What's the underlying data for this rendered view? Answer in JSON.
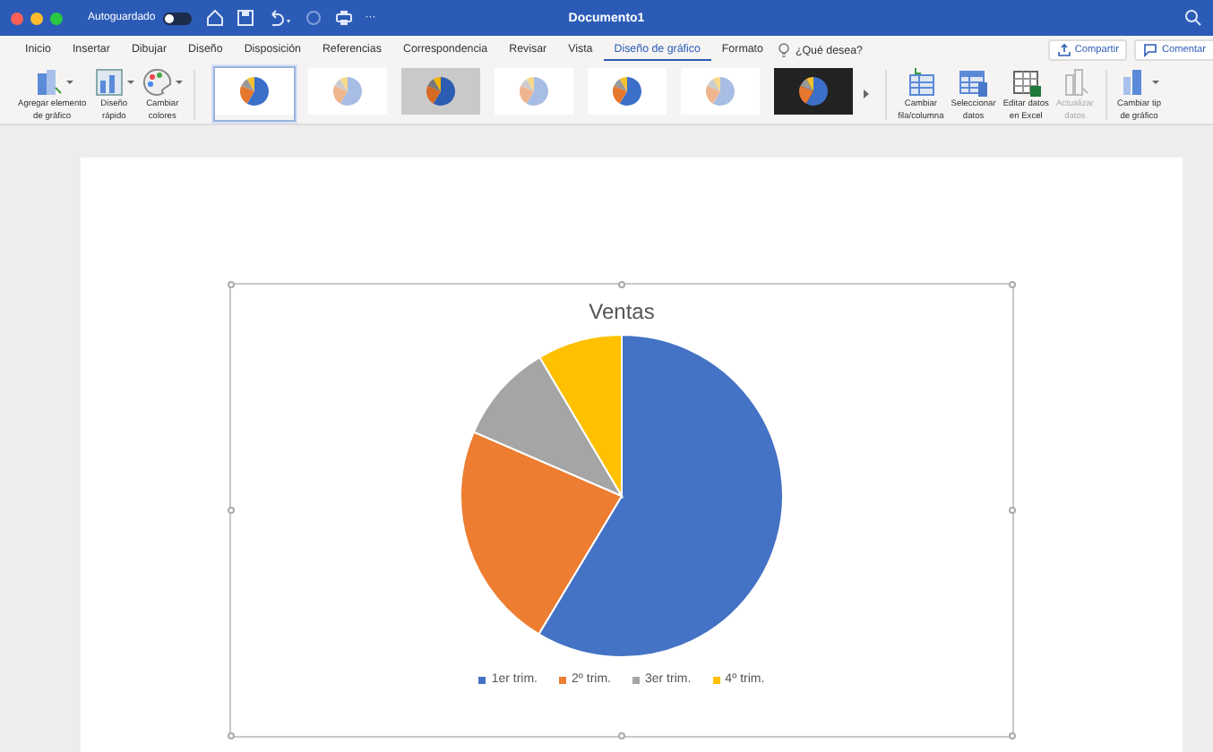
{
  "title_bar": {
    "autosave_label": "Autoguardado",
    "autosave_on": false,
    "overflow": "···",
    "title": "Documento1"
  },
  "tabs": [
    {
      "label": "Inicio",
      "selected": false
    },
    {
      "label": "Insertar",
      "selected": false
    },
    {
      "label": "Dibujar",
      "selected": false
    },
    {
      "label": "Diseño",
      "selected": false
    },
    {
      "label": "Disposición",
      "selected": false
    },
    {
      "label": "Referencias",
      "selected": false
    },
    {
      "label": "Correspondencia",
      "selected": false
    },
    {
      "label": "Revisar",
      "selected": false
    },
    {
      "label": "Vista",
      "selected": false
    },
    {
      "label": "Diseño de gráfico",
      "selected": true
    },
    {
      "label": "Formato",
      "selected": false
    }
  ],
  "tell_me": "¿Qué desea?",
  "share_button": "Compartir",
  "comments_button": "Comentar",
  "ribbon": {
    "left_buttons": [
      {
        "lines": [
          "Agregar elemento",
          "de gráfico"
        ],
        "dropdown": true
      },
      {
        "lines": [
          "Diseño",
          "rápido"
        ],
        "dropdown": true
      },
      {
        "lines": [
          "Cambiar",
          "colores"
        ],
        "dropdown": true
      }
    ],
    "styles": [
      {
        "kind": "plain",
        "selected": true
      },
      {
        "kind": "pale",
        "selected": false
      },
      {
        "kind": "shaded",
        "selected": false
      },
      {
        "kind": "pale",
        "selected": false
      },
      {
        "kind": "plain",
        "selected": false
      },
      {
        "kind": "pale",
        "selected": false
      },
      {
        "kind": "dark",
        "selected": false
      }
    ],
    "right_buttons": [
      {
        "lines": [
          "Cambiar",
          "fila/columna"
        ],
        "disabled": false,
        "dropdown": false
      },
      {
        "lines": [
          "Seleccionar",
          "datos"
        ],
        "disabled": false,
        "dropdown": false
      },
      {
        "lines": [
          "Editar datos",
          "en Excel"
        ],
        "disabled": false,
        "dropdown": false
      },
      {
        "lines": [
          "Actualizar",
          "datos"
        ],
        "disabled": true,
        "dropdown": false
      },
      {
        "lines": [
          "Cambiar tip",
          "de gráfico"
        ],
        "disabled": false,
        "dropdown": true
      }
    ]
  },
  "chart": {
    "title": "Ventas",
    "legend": [
      {
        "label": "1er trim.",
        "color": "#4472c4"
      },
      {
        "label": "2º trim.",
        "color": "#ed7d31"
      },
      {
        "label": "3er trim.",
        "color": "#a5a5a5"
      },
      {
        "label": "4º trim.",
        "color": "#ffc000"
      }
    ]
  }
}
